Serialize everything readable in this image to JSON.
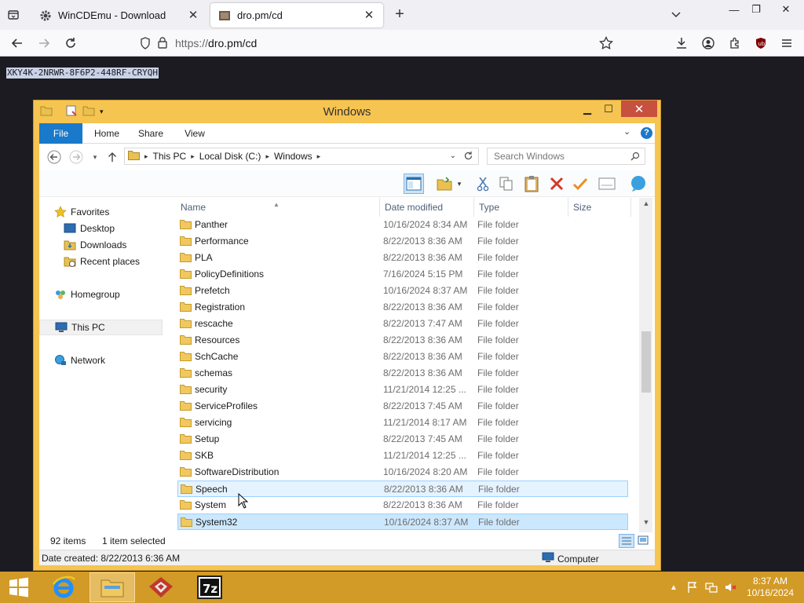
{
  "browser": {
    "tabs": [
      {
        "title": "WinCDEmu - Download",
        "favicon": "gear-icon",
        "active": false
      },
      {
        "title": "dro.pm/cd",
        "favicon": "page-thumbnail-icon",
        "active": true
      }
    ],
    "url_prefix": "https://",
    "url_host": "dro.pm/cd",
    "accent": "#f0f0f4"
  },
  "page": {
    "license_key": "XKY4K-2NRWR-8F6P2-448RF-CRYQH"
  },
  "explorer": {
    "window_title": "Windows",
    "ribbon_tabs": [
      "File",
      "Home",
      "Share",
      "View"
    ],
    "breadcrumb": [
      "This PC",
      "Local Disk (C:)",
      "Windows"
    ],
    "search_placeholder": "Search Windows",
    "nav": {
      "favorites": "Favorites",
      "desktop": "Desktop",
      "downloads": "Downloads",
      "recent": "Recent places",
      "homegroup": "Homegroup",
      "thispc": "This PC",
      "network": "Network"
    },
    "columns": [
      "Name",
      "Date modified",
      "Type",
      "Size"
    ],
    "files": [
      {
        "name": "Panther",
        "date": "10/16/2024 8:34 AM",
        "type": "File folder"
      },
      {
        "name": "Performance",
        "date": "8/22/2013 8:36 AM",
        "type": "File folder"
      },
      {
        "name": "PLA",
        "date": "8/22/2013 8:36 AM",
        "type": "File folder"
      },
      {
        "name": "PolicyDefinitions",
        "date": "7/16/2024 5:15 PM",
        "type": "File folder"
      },
      {
        "name": "Prefetch",
        "date": "10/16/2024 8:37 AM",
        "type": "File folder"
      },
      {
        "name": "Registration",
        "date": "8/22/2013 8:36 AM",
        "type": "File folder"
      },
      {
        "name": "rescache",
        "date": "8/22/2013 7:47 AM",
        "type": "File folder"
      },
      {
        "name": "Resources",
        "date": "8/22/2013 8:36 AM",
        "type": "File folder"
      },
      {
        "name": "SchCache",
        "date": "8/22/2013 8:36 AM",
        "type": "File folder"
      },
      {
        "name": "schemas",
        "date": "8/22/2013 8:36 AM",
        "type": "File folder"
      },
      {
        "name": "security",
        "date": "11/21/2014 12:25 ...",
        "type": "File folder"
      },
      {
        "name": "ServiceProfiles",
        "date": "8/22/2013 7:45 AM",
        "type": "File folder"
      },
      {
        "name": "servicing",
        "date": "11/21/2014 8:17 AM",
        "type": "File folder"
      },
      {
        "name": "Setup",
        "date": "8/22/2013 7:45 AM",
        "type": "File folder"
      },
      {
        "name": "SKB",
        "date": "11/21/2014 12:25 ...",
        "type": "File folder"
      },
      {
        "name": "SoftwareDistribution",
        "date": "10/16/2024 8:20 AM",
        "type": "File folder"
      },
      {
        "name": "Speech",
        "date": "8/22/2013 8:36 AM",
        "type": "File folder",
        "state": "hover"
      },
      {
        "name": "System",
        "date": "8/22/2013 8:36 AM",
        "type": "File folder"
      },
      {
        "name": "System32",
        "date": "10/16/2024 8:37 AM",
        "type": "File folder",
        "state": "selected"
      }
    ],
    "status": {
      "item_count": "92 items",
      "selection": "1 item selected",
      "date_created": "Date created: 8/22/2013 6:36 AM",
      "location": "Computer"
    }
  },
  "taskbar": {
    "apps": [
      "internet-explorer-icon",
      "file-explorer-icon",
      "wincdemu-icon",
      "7zip-icon"
    ],
    "time": "8:37 AM",
    "date": "10/16/2024",
    "seven_zip_label": "7z"
  },
  "colors": {
    "window_frame": "#f6c451",
    "taskbar": "#d29a27",
    "selection": "#cce8ff",
    "file_tab": "#1979ca",
    "close_button": "#c7503f"
  }
}
